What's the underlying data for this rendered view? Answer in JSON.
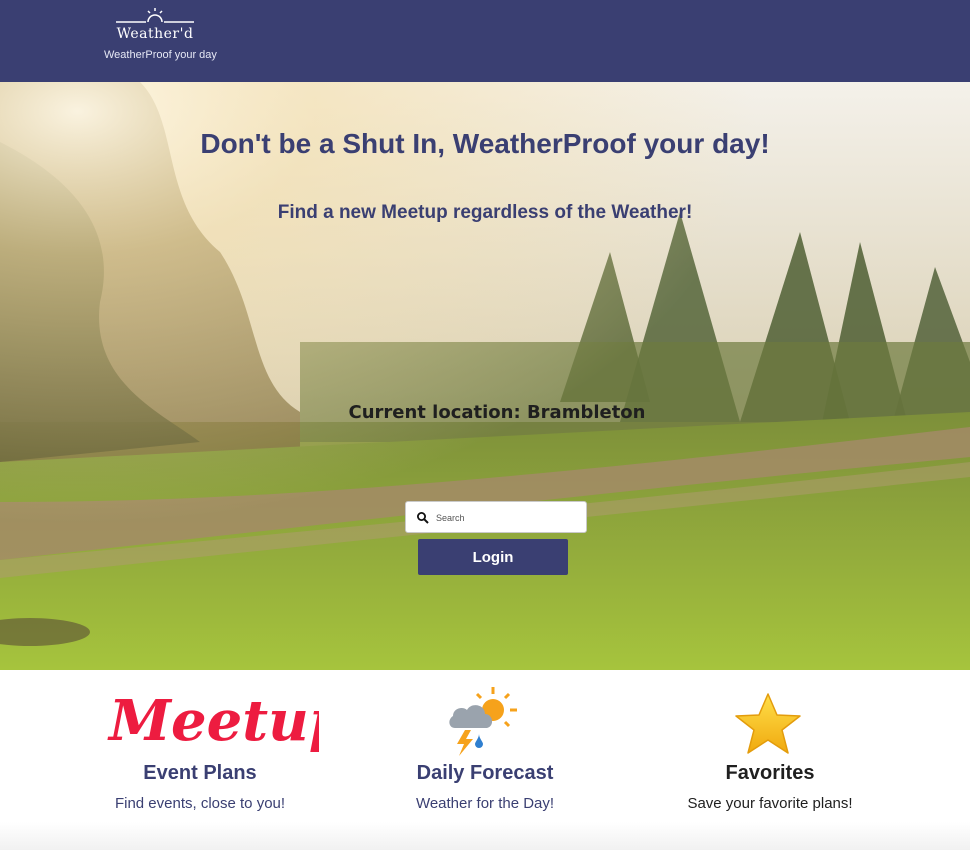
{
  "header": {
    "logo_name": "Weather'd",
    "tagline": "WeatherProof your day",
    "background": "#3a3f72"
  },
  "hero": {
    "title": "Don't be a Shut In, WeatherProof your day!",
    "subtitle": "Find a new Meetup regardless of the Weather!",
    "location": "Current location: Brambleton",
    "search_placeholder": "Search",
    "login_label": "Login"
  },
  "features": [
    {
      "title": "Event Plans",
      "description": "Find events, close to you!",
      "icon": "meetup-logo",
      "logo_text": "Meetup"
    },
    {
      "title": "Daily Forecast",
      "description": "Weather for the Day!",
      "icon": "weather-icon"
    },
    {
      "title": "Favorites",
      "description": "Save your favorite plans!",
      "icon": "star-icon"
    }
  ],
  "colors": {
    "accent": "#3a3f72",
    "meetup": "#ed1c40",
    "star": "#f7c21b"
  }
}
